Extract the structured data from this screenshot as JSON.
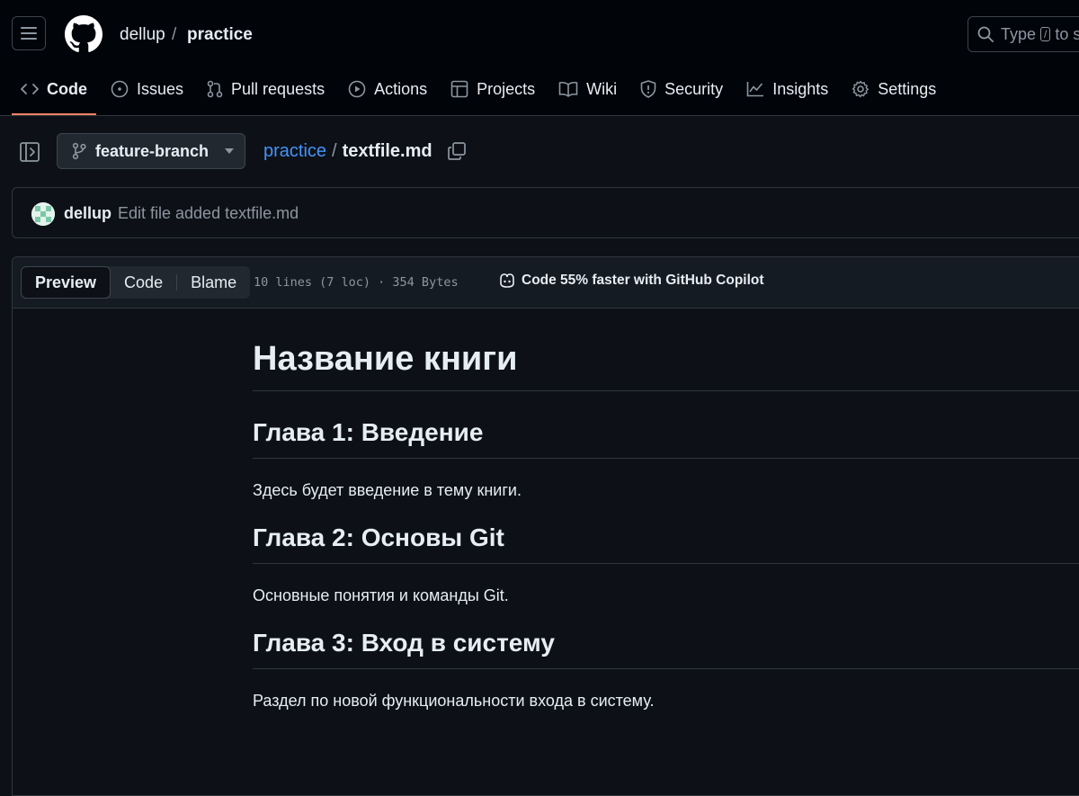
{
  "header": {
    "owner": "dellup",
    "separator": "/",
    "repo": "practice",
    "search": {
      "prefix": "Type",
      "key": "/",
      "suffix": "to s"
    }
  },
  "tabs": [
    {
      "label": "Code",
      "icon": "code-icon",
      "active": true
    },
    {
      "label": "Issues",
      "icon": "issue-icon"
    },
    {
      "label": "Pull requests",
      "icon": "pull-request-icon"
    },
    {
      "label": "Actions",
      "icon": "play-icon"
    },
    {
      "label": "Projects",
      "icon": "table-icon"
    },
    {
      "label": "Wiki",
      "icon": "book-icon"
    },
    {
      "label": "Security",
      "icon": "shield-icon"
    },
    {
      "label": "Insights",
      "icon": "graph-icon"
    },
    {
      "label": "Settings",
      "icon": "gear-icon"
    }
  ],
  "breadcrumb": {
    "branch": "feature-branch",
    "repo": "practice",
    "separator": "/",
    "file": "textfile.md"
  },
  "commit": {
    "user": "dellup",
    "message": "Edit file added textfile.md"
  },
  "file_header": {
    "views": [
      "Preview",
      "Code",
      "Blame"
    ],
    "active_view": "Preview",
    "meta": "10 lines (7 loc) · 354 Bytes",
    "copilot": "Code 55% faster with GitHub Copilot"
  },
  "markdown": {
    "h1": "Название книги",
    "sections": [
      {
        "heading": "Глава 1: Введение",
        "text": "Здесь будет введение в тему книги."
      },
      {
        "heading": "Глава 2: Основы Git",
        "text": "Основные понятия и команды Git."
      },
      {
        "heading": "Глава 3: Вход в систему",
        "text": "Раздел по новой функциональности входа в систему."
      }
    ]
  },
  "colors": {
    "background": "#0d1117",
    "header_background": "#010409",
    "link": "#4493f8",
    "active_tab_underline": "#f78166",
    "muted_text": "#8d96a0"
  }
}
